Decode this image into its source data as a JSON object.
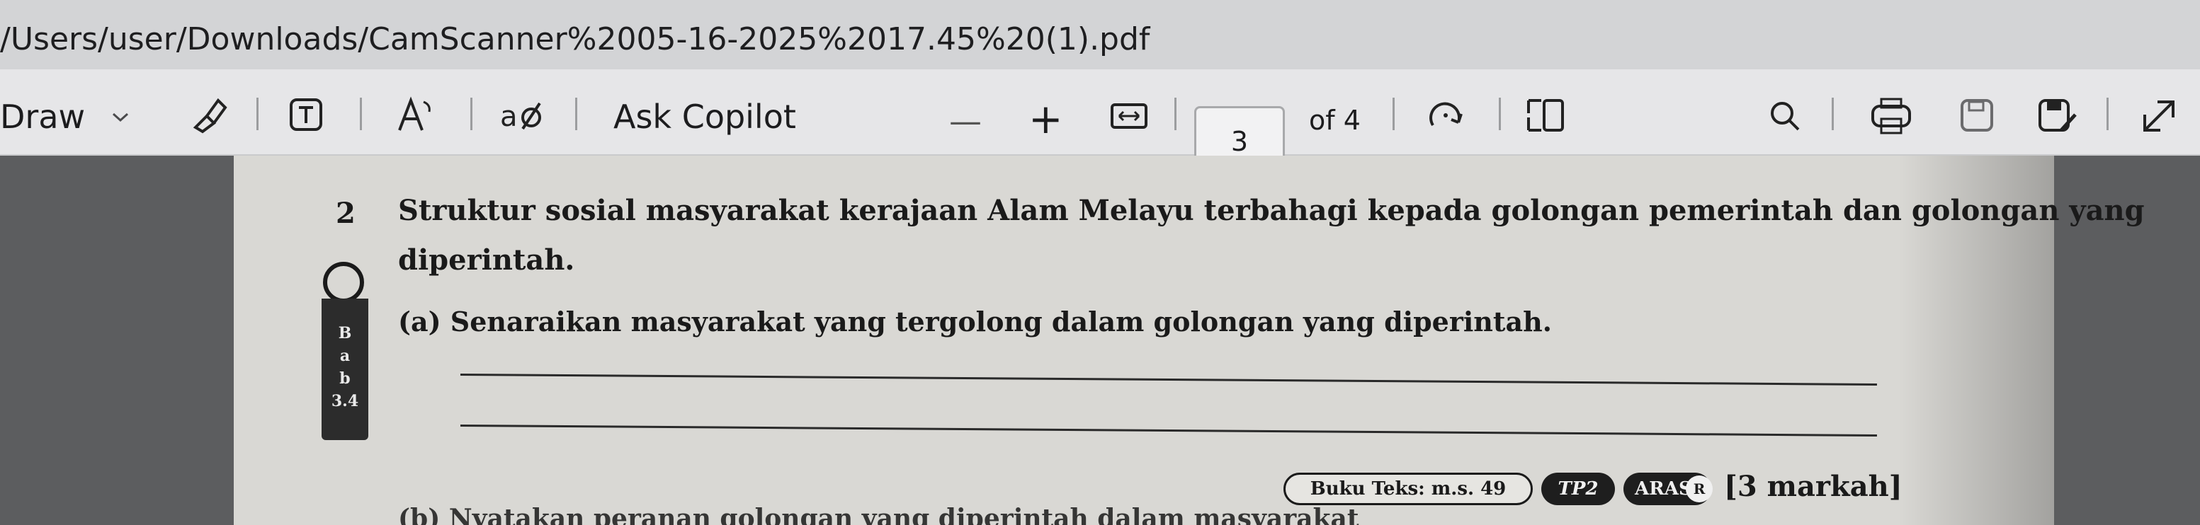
{
  "address_bar": {
    "path": "/Users/user/Downloads/CamScanner%2005-16-2025%2017.45%20(1).pdf"
  },
  "toolbar": {
    "draw_label": "Draw",
    "ask_copilot_label": "Ask Copilot",
    "zoom_out_label": "—",
    "zoom_in_label": "+",
    "current_page": "3",
    "page_total_label": "of 4",
    "icons": {
      "draw_dropdown": "chevron-down-icon",
      "highlight": "highlighter-icon",
      "text": "text-box-icon",
      "read_aloud": "read-aloud-icon",
      "erase": "eraser-icon",
      "fit": "fit-to-page-icon",
      "rotate": "rotate-icon",
      "page_view": "page-view-icon",
      "search": "search-icon",
      "print": "print-icon",
      "save": "save-icon",
      "save_as": "save-as-icon",
      "expand": "expand-icon"
    }
  },
  "document": {
    "question_number": "2",
    "question_line1": "Struktur sosial masyarakat kerajaan Alam Melayu terbahagi kepada golongan pemerintah dan golongan yang",
    "question_line2": "diperintah.",
    "part_a": "(a)  Senaraikan masyarakat yang tergolong dalam golongan yang diperintah.",
    "side_tag": {
      "letters": [
        "B",
        "a",
        "b"
      ],
      "code": "3.4"
    },
    "reference": {
      "book": "Buku Teks: m.s. 49",
      "tp": "TP2",
      "aras": "ARAS:",
      "aras_level": "R",
      "marks": "[3 markah]"
    },
    "part_b_partial": "(b)  Nyatakan peranan golongan yang diperintah dalam masyarakat"
  }
}
